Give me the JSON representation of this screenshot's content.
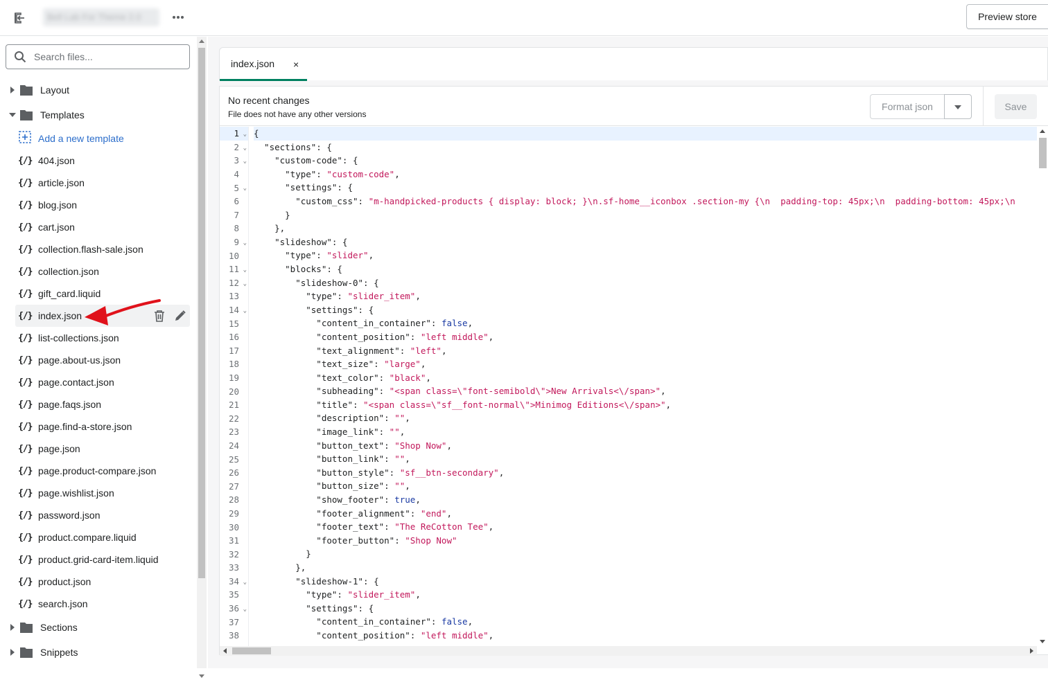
{
  "topbar": {
    "theme_name": "Bell Lab For Theme 2.0",
    "preview_label": "Preview store"
  },
  "sidebar": {
    "search_placeholder": "Search files...",
    "folders": {
      "layout": "Layout",
      "templates": "Templates",
      "sections": "Sections",
      "snippets": "Snippets"
    },
    "add_template": "Add a new template",
    "file_icon": "{/}",
    "files": [
      "404.json",
      "article.json",
      "blog.json",
      "cart.json",
      "collection.flash-sale.json",
      "collection.json",
      "gift_card.liquid",
      "index.json",
      "list-collections.json",
      "page.about-us.json",
      "page.contact.json",
      "page.faqs.json",
      "page.find-a-store.json",
      "page.json",
      "page.product-compare.json",
      "page.wishlist.json",
      "password.json",
      "product.compare.liquid",
      "product.grid-card-item.liquid",
      "product.json",
      "search.json"
    ],
    "active_file": "index.json"
  },
  "tab": {
    "name": "index.json",
    "close": "×"
  },
  "editor": {
    "title": "No recent changes",
    "subtitle": "File does not have any other versions",
    "format_label": "Format json",
    "save_label": "Save"
  },
  "code_lines": [
    [
      [
        "k",
        "{"
      ]
    ],
    [
      [
        "k",
        "  \"sections\": {"
      ]
    ],
    [
      [
        "k",
        "    \"custom-code\": {"
      ]
    ],
    [
      [
        "k",
        "      \"type\": "
      ],
      [
        "s",
        "\"custom-code\""
      ],
      [
        "k",
        ","
      ]
    ],
    [
      [
        "k",
        "      \"settings\": {"
      ]
    ],
    [
      [
        "k",
        "        \"custom_css\": "
      ],
      [
        "s",
        "\"m-handpicked-products { display: block; }\\n.sf-home__iconbox .section-my {\\n  padding-top: 45px;\\n  padding-bottom: 45px;\\n"
      ]
    ],
    [
      [
        "k",
        "      }"
      ]
    ],
    [
      [
        "k",
        "    },"
      ]
    ],
    [
      [
        "k",
        "    \"slideshow\": {"
      ]
    ],
    [
      [
        "k",
        "      \"type\": "
      ],
      [
        "s",
        "\"slider\""
      ],
      [
        "k",
        ","
      ]
    ],
    [
      [
        "k",
        "      \"blocks\": {"
      ]
    ],
    [
      [
        "k",
        "        \"slideshow-0\": {"
      ]
    ],
    [
      [
        "k",
        "          \"type\": "
      ],
      [
        "s",
        "\"slider_item\""
      ],
      [
        "k",
        ","
      ]
    ],
    [
      [
        "k",
        "          \"settings\": {"
      ]
    ],
    [
      [
        "k",
        "            \"content_in_container\": "
      ],
      [
        "b",
        "false"
      ],
      [
        "k",
        ","
      ]
    ],
    [
      [
        "k",
        "            \"content_position\": "
      ],
      [
        "s",
        "\"left middle\""
      ],
      [
        "k",
        ","
      ]
    ],
    [
      [
        "k",
        "            \"text_alignment\": "
      ],
      [
        "s",
        "\"left\""
      ],
      [
        "k",
        ","
      ]
    ],
    [
      [
        "k",
        "            \"text_size\": "
      ],
      [
        "s",
        "\"large\""
      ],
      [
        "k",
        ","
      ]
    ],
    [
      [
        "k",
        "            \"text_color\": "
      ],
      [
        "s",
        "\"black\""
      ],
      [
        "k",
        ","
      ]
    ],
    [
      [
        "k",
        "            \"subheading\": "
      ],
      [
        "s",
        "\"<span class=\\\"font-semibold\\\">New Arrivals<\\/span>\""
      ],
      [
        "k",
        ","
      ]
    ],
    [
      [
        "k",
        "            \"title\": "
      ],
      [
        "s",
        "\"<span class=\\\"sf__font-normal\\\">Minimog Editions<\\/span>\""
      ],
      [
        "k",
        ","
      ]
    ],
    [
      [
        "k",
        "            \"description\": "
      ],
      [
        "s",
        "\"\""
      ],
      [
        "k",
        ","
      ]
    ],
    [
      [
        "k",
        "            \"image_link\": "
      ],
      [
        "s",
        "\"\""
      ],
      [
        "k",
        ","
      ]
    ],
    [
      [
        "k",
        "            \"button_text\": "
      ],
      [
        "s",
        "\"Shop Now\""
      ],
      [
        "k",
        ","
      ]
    ],
    [
      [
        "k",
        "            \"button_link\": "
      ],
      [
        "s",
        "\"\""
      ],
      [
        "k",
        ","
      ]
    ],
    [
      [
        "k",
        "            \"button_style\": "
      ],
      [
        "s",
        "\"sf__btn-secondary\""
      ],
      [
        "k",
        ","
      ]
    ],
    [
      [
        "k",
        "            \"button_size\": "
      ],
      [
        "s",
        "\"\""
      ],
      [
        "k",
        ","
      ]
    ],
    [
      [
        "k",
        "            \"show_footer\": "
      ],
      [
        "b",
        "true"
      ],
      [
        "k",
        ","
      ]
    ],
    [
      [
        "k",
        "            \"footer_alignment\": "
      ],
      [
        "s",
        "\"end\""
      ],
      [
        "k",
        ","
      ]
    ],
    [
      [
        "k",
        "            \"footer_text\": "
      ],
      [
        "s",
        "\"The ReCotton Tee\""
      ],
      [
        "k",
        ","
      ]
    ],
    [
      [
        "k",
        "            \"footer_button\": "
      ],
      [
        "s",
        "\"Shop Now\""
      ]
    ],
    [
      [
        "k",
        "          }"
      ]
    ],
    [
      [
        "k",
        "        },"
      ]
    ],
    [
      [
        "k",
        "        \"slideshow-1\": {"
      ]
    ],
    [
      [
        "k",
        "          \"type\": "
      ],
      [
        "s",
        "\"slider_item\""
      ],
      [
        "k",
        ","
      ]
    ],
    [
      [
        "k",
        "          \"settings\": {"
      ]
    ],
    [
      [
        "k",
        "            \"content_in_container\": "
      ],
      [
        "b",
        "false"
      ],
      [
        "k",
        ","
      ]
    ],
    [
      [
        "k",
        "            \"content_position\": "
      ],
      [
        "s",
        "\"left middle\""
      ],
      [
        "k",
        ","
      ]
    ]
  ],
  "fold_lines": [
    1,
    2,
    3,
    5,
    9,
    11,
    12,
    14,
    34,
    36
  ],
  "active_line": 1,
  "colors": {
    "accent": "#008060",
    "link": "#2c6ecb",
    "string": "#c2185b",
    "boolean": "#1a3aa3",
    "annotation_arrow": "#e0121b"
  }
}
